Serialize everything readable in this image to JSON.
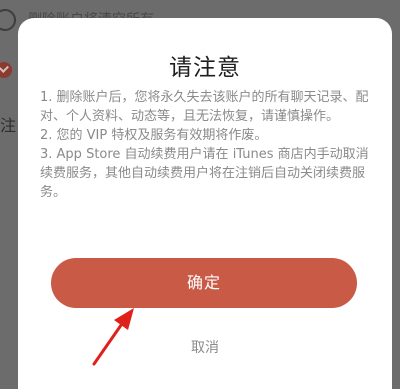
{
  "background": {
    "row_text": "删除账户将清空所有",
    "side_text": "注"
  },
  "modal": {
    "title": "请注意",
    "body": [
      "1. 删除账户后，您将永久失去该账户的所有聊天记录、配对、个人资料、动态等，且无法恢复，请谨慎操作。",
      "2. 您的 VIP 特权及服务有效期将作废。",
      "3. App Store 自动续费用户请在 iTunes 商店内手动取消续费服务，其他自动续费用户将在注销后自动关闭续费服务。"
    ],
    "confirm_label": "确定",
    "cancel_label": "取消"
  },
  "colors": {
    "accent": "#c85a46",
    "annotation_arrow": "#e0201a"
  },
  "annotation": {
    "arrow_icon": "red-pointer-arrow"
  }
}
